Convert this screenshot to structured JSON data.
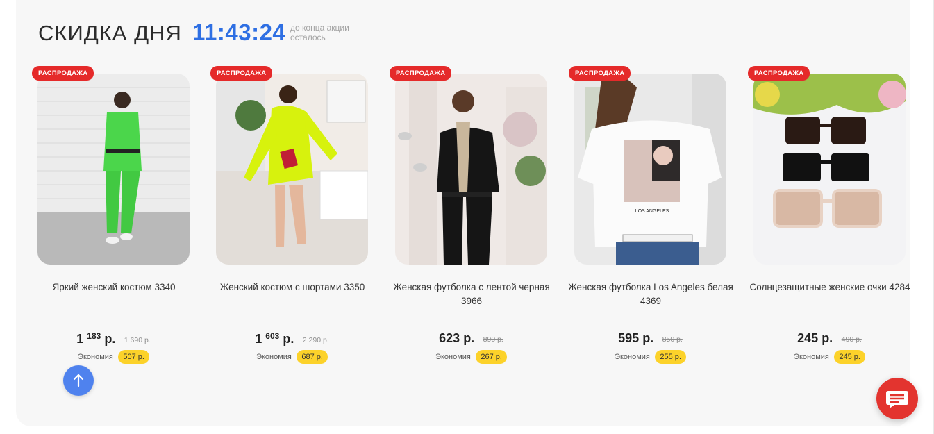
{
  "section": {
    "title": "СКИДКА ДНЯ",
    "timer": "11:43:24",
    "timer_note": "до конца акции осталось"
  },
  "products": [
    {
      "badge": "РАСПРОДАЖА",
      "name": "Яркий женский костюм 3340",
      "price_main": "1",
      "price_sup": "183",
      "price_suffix": "р.",
      "old_price": "1 690 р.",
      "economy_label": "Экономия",
      "economy": "507 р."
    },
    {
      "badge": "РАСПРОДАЖА",
      "name": "Женский костюм с шортами 3350",
      "price_main": "1",
      "price_sup": "603",
      "price_suffix": "р.",
      "old_price": "2 290 р.",
      "economy_label": "Экономия",
      "economy": "687 р."
    },
    {
      "badge": "РАСПРОДАЖА",
      "name": "Женская футболка с лентой черная 3966",
      "price": "623 р.",
      "old_price": "890 р.",
      "economy_label": "Экономия",
      "economy": "267 р."
    },
    {
      "badge": "РАСПРОДАЖА",
      "name": "Женская футболка Los Angeles белая 4369",
      "price": "595 р.",
      "old_price": "850 р.",
      "economy_label": "Экономия",
      "economy": "255 р."
    },
    {
      "badge": "РАСПРОДАЖА",
      "name": "Солнцезащитные женские очки 4284",
      "price": "245 р.",
      "old_price": "490 р.",
      "economy_label": "Экономия",
      "economy": "245 р."
    }
  ],
  "photo_print_text": "LOS ANGELES",
  "icons": {
    "scroll_up": "arrow-up-icon",
    "chat": "chat-icon"
  },
  "colors": {
    "timer": "#2e6fe3",
    "badge": "#e52a2a",
    "economy_pill": "#fcd22a",
    "scroll_up_button": "#4f82ee",
    "chat_button": "#e3342f"
  }
}
